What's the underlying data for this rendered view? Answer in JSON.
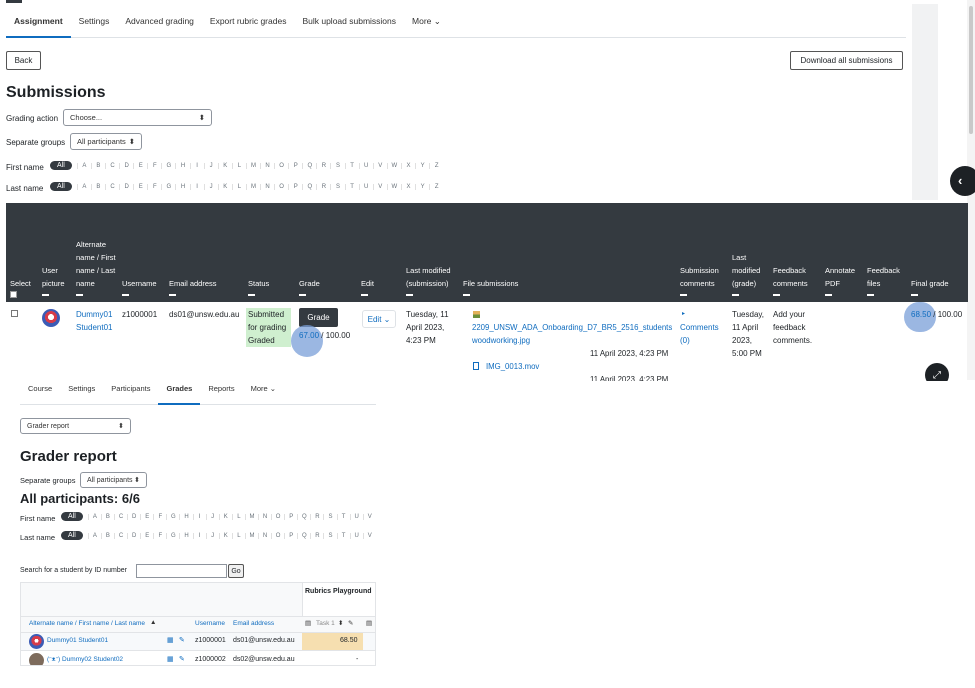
{
  "assignment": {
    "tabs": [
      "Assignment",
      "Settings",
      "Advanced grading",
      "Export rubric grades",
      "Bulk upload submissions",
      "More ⌄"
    ],
    "back_label": "Back",
    "download_label": "Download all submissions",
    "heading": "Submissions",
    "grading_action_label": "Grading action",
    "grading_action_value": "Choose...",
    "separate_groups_label": "Separate groups",
    "separate_groups_value": "All participants",
    "first_name_label": "First name",
    "last_name_label": "Last name",
    "all_label": "All",
    "letters": [
      "A",
      "B",
      "C",
      "D",
      "E",
      "F",
      "G",
      "H",
      "I",
      "J",
      "K",
      "L",
      "M",
      "N",
      "O",
      "P",
      "Q",
      "R",
      "S",
      "T",
      "U",
      "V",
      "W",
      "X",
      "Y",
      "Z"
    ],
    "columns": {
      "select": "Select",
      "user_picture": "User picture",
      "alt_name": "Alternate name / First name / Last name",
      "username": "Username",
      "email": "Email address",
      "status": "Status",
      "grade": "Grade",
      "edit": "Edit",
      "last_modified_sub": "Last modified (submission)",
      "file_submissions": "File submissions",
      "submission_comments": "Submission comments",
      "last_modified_grade": "Last modified (grade)",
      "feedback_comments": "Feedback comments",
      "annotate_pdf": "Annotate PDF",
      "feedback_files": "Feedback files",
      "final_grade": "Final grade"
    },
    "row": {
      "name": "Dummy01 Student01",
      "username": "z1000001",
      "email": "ds01@unsw.edu.au",
      "status": "Submitted for grading Graded",
      "grade_button": "Grade",
      "grade_value": "67.00",
      "grade_max": " / 100.00",
      "edit_label": "Edit ⌄",
      "last_modified": "Tuesday, 11 April 2023, 4:23 PM",
      "file1_name": "2209_UNSW_ADA_Onboarding_D7_BR5_2516_students woodworking.jpg",
      "file1_date": "11 April 2023, 4:23 PM",
      "file2_name": "IMG_0013.mov",
      "file2_date": "11 April 2023, 4:23 PM",
      "comments_label": "Comments (0)",
      "last_modified_grade": "Tuesday, 11 April 2023, 5:00 PM",
      "feedback_comments": "Add your feedback comments.",
      "final_grade_value": "68.50",
      "final_grade_max": " / 100.00"
    }
  },
  "grader": {
    "tabs": [
      "Course",
      "Settings",
      "Participants",
      "Grades",
      "Reports",
      "More ⌄"
    ],
    "report_select": "Grader report",
    "heading": "Grader report",
    "separate_groups_label": "Separate groups",
    "separate_groups_value": "All participants",
    "participants_heading": "All participants: 6/6",
    "first_name_label": "First name",
    "last_name_label": "Last name",
    "all_label": "All",
    "letters": [
      "A",
      "B",
      "C",
      "D",
      "E",
      "F",
      "G",
      "H",
      "I",
      "J",
      "K",
      "L",
      "M",
      "N",
      "O",
      "P",
      "Q",
      "R",
      "S",
      "T",
      "U",
      "V"
    ],
    "search_label": "Search for a student by ID number",
    "go_label": "Go",
    "category_header": "Rubrics Playground",
    "col_name": "Alternate name / First name / Last name",
    "col_username": "Username",
    "col_email": "Email address",
    "col_task": "Task 1",
    "rows": [
      {
        "name": "Dummy01 Student01",
        "username": "z1000001",
        "email": "ds01@unsw.edu.au",
        "grade": "68.50"
      },
      {
        "name": "(ᵔᴥᵔ) Dummy02 Student02",
        "username": "z1000002",
        "email": "ds02@unsw.edu.au",
        "grade": "-"
      }
    ]
  },
  "colors": {
    "table_header": "#343a40",
    "link": "#0f6cbf",
    "status_green": "#cfefcf",
    "highlight_circle": "#7a9fd8",
    "grade_cell": "#f6dfb0"
  }
}
